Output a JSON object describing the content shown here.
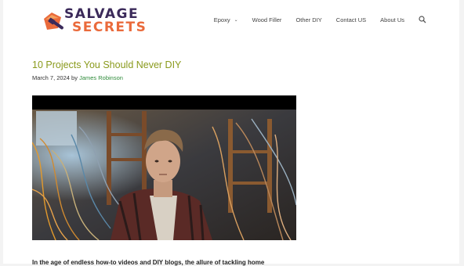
{
  "brand": {
    "line1": "SALVAGE",
    "line2": "SECRETS",
    "colors": {
      "dark": "#3b2a5a",
      "accent": "#ea6a3b"
    }
  },
  "nav": {
    "items": [
      {
        "label": "Epoxy",
        "has_dropdown": true
      },
      {
        "label": "Wood Filler"
      },
      {
        "label": "Other DIY"
      },
      {
        "label": "Contact US"
      },
      {
        "label": "About Us"
      }
    ],
    "search_icon": "search-icon"
  },
  "article": {
    "title": "10 Projects You Should Never DIY",
    "date": "March 7, 2024",
    "by": "by",
    "author": "James Robinson",
    "intro": "In the age of endless how-to videos and DIY blogs, the allure of tackling home"
  },
  "colors": {
    "title": "#8a9a1c",
    "author_link": "#2e8b3a"
  }
}
